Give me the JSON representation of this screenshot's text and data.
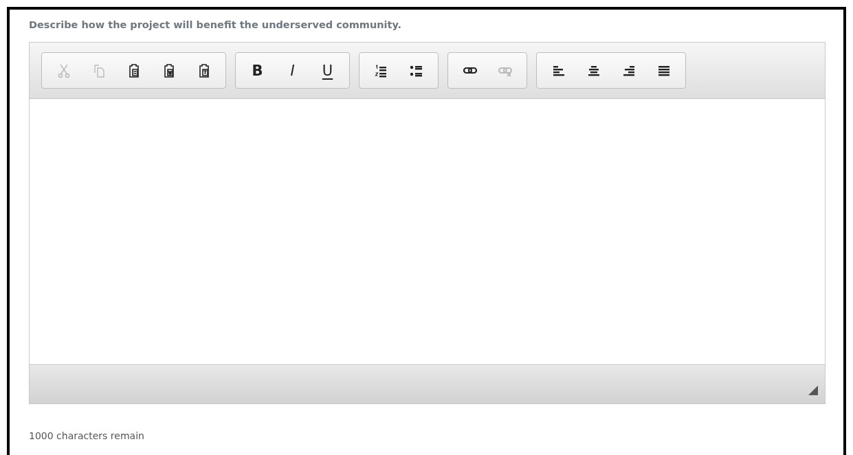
{
  "prompt": "Describe how the project will benefit the underserved community.",
  "toolbar": [
    {
      "buttons": [
        {
          "kind": "cut",
          "disabled": true
        },
        {
          "kind": "copy",
          "disabled": true
        },
        {
          "kind": "paste",
          "disabled": false
        },
        {
          "kind": "paste-word",
          "disabled": false
        },
        {
          "kind": "paste-text",
          "disabled": false
        }
      ]
    },
    {
      "buttons": [
        {
          "kind": "bold",
          "label": "B",
          "disabled": false
        },
        {
          "kind": "italic",
          "label": "I",
          "disabled": false
        },
        {
          "kind": "underline",
          "label": "U",
          "disabled": false
        }
      ]
    },
    {
      "buttons": [
        {
          "kind": "numbered-list",
          "disabled": false
        },
        {
          "kind": "bulleted-list",
          "disabled": false
        }
      ]
    },
    {
      "buttons": [
        {
          "kind": "link",
          "disabled": false
        },
        {
          "kind": "unlink",
          "disabled": true
        }
      ]
    },
    {
      "buttons": [
        {
          "kind": "align-left",
          "disabled": false
        },
        {
          "kind": "align-center",
          "disabled": false
        },
        {
          "kind": "align-right",
          "disabled": false
        },
        {
          "kind": "justify",
          "disabled": false
        }
      ]
    }
  ],
  "counter": "1000 characters remain"
}
